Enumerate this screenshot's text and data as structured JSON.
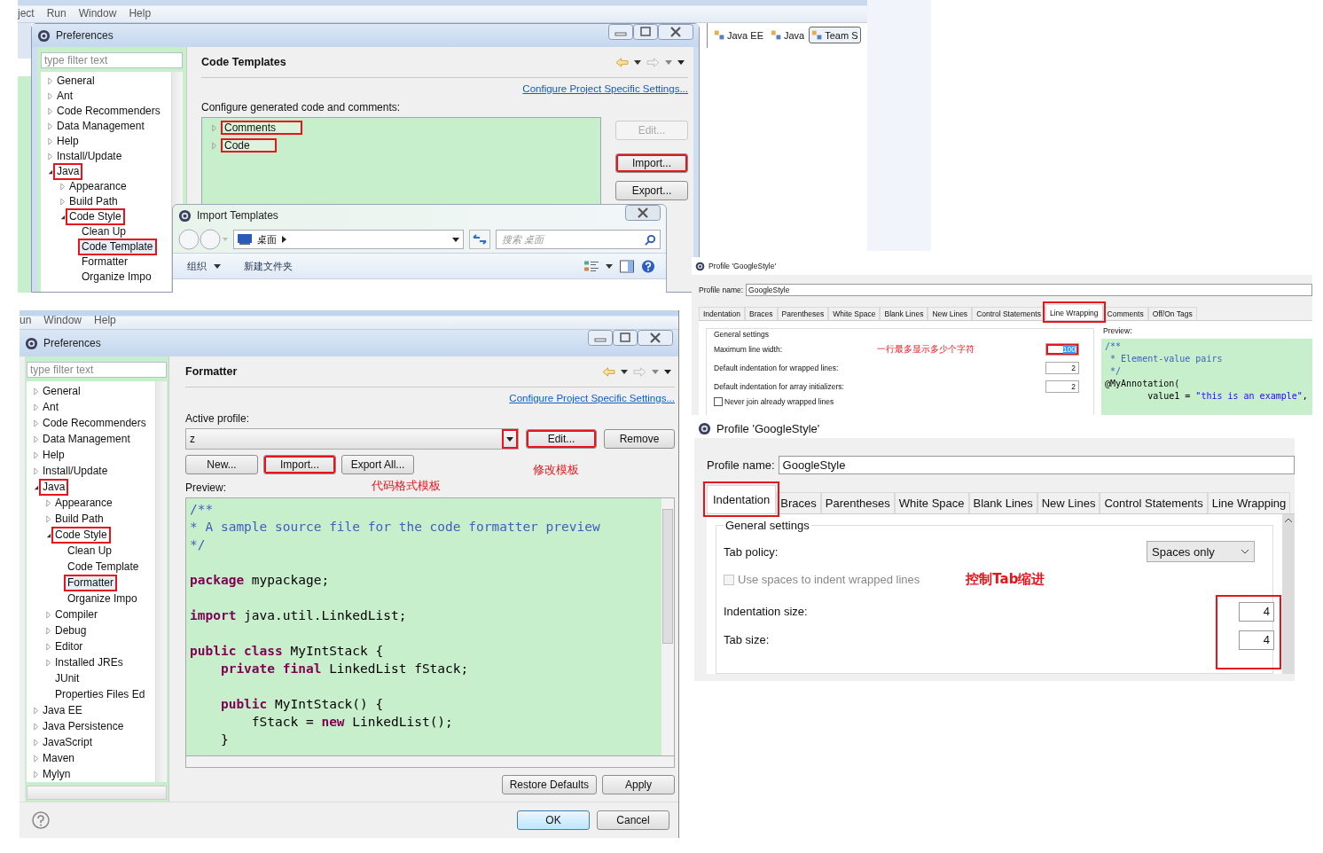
{
  "code_templates_window": {
    "menu": [
      "ject",
      "Run",
      "Window",
      "Help"
    ],
    "title": "Preferences",
    "filter": {
      "placeholder": "type filter text"
    },
    "tree": [
      {
        "label": "General",
        "expanded": false,
        "selected": false,
        "highlighted": false
      },
      {
        "label": "Ant",
        "expanded": false,
        "selected": false,
        "highlighted": false
      },
      {
        "label": "Code Recommenders",
        "expanded": false,
        "selected": false,
        "highlighted": false
      },
      {
        "label": "Data Management",
        "expanded": false,
        "selected": false,
        "highlighted": false
      },
      {
        "label": "Help",
        "expanded": false,
        "selected": false,
        "highlighted": false
      },
      {
        "label": "Install/Update",
        "expanded": false,
        "selected": false,
        "highlighted": false
      },
      {
        "label": "Java",
        "expanded": true,
        "selected": false,
        "highlighted": true,
        "children": [
          {
            "label": "Appearance",
            "expanded": false,
            "selected": false,
            "highlighted": false
          },
          {
            "label": "Build Path",
            "expanded": false,
            "selected": false,
            "highlighted": false
          },
          {
            "label": "Code Style",
            "expanded": true,
            "selected": false,
            "highlighted": true,
            "children": [
              {
                "label": "Clean Up",
                "selected": false,
                "highlighted": false
              },
              {
                "label": "Code Template",
                "selected": true,
                "highlighted": true
              },
              {
                "label": "Formatter",
                "selected": false,
                "highlighted": false
              },
              {
                "label": "Organize Impo",
                "selected": false,
                "highlighted": false
              }
            ]
          }
        ]
      }
    ],
    "page_title": "Code Templates",
    "link": "Configure Project Specific Settings...",
    "description": "Configure generated code and comments:",
    "templates": [
      {
        "label": "Comments",
        "expanded": false,
        "highlighted": true
      },
      {
        "label": "Code",
        "expanded": false,
        "highlighted": true
      }
    ],
    "buttons": [
      {
        "label": "Edit...",
        "disabled": true,
        "highlighted": false
      },
      {
        "label": "Import...",
        "disabled": false,
        "highlighted": true
      },
      {
        "label": "Export...",
        "disabled": false,
        "highlighted": false
      }
    ],
    "perspectives": [
      {
        "label": "Java EE",
        "selected": false
      },
      {
        "label": "Java",
        "selected": false
      },
      {
        "label": "Team S",
        "selected": true
      }
    ],
    "import_dialog": {
      "title": "Import Templates",
      "location": "桌面",
      "search": {
        "placeholder": "搜索 桌面"
      },
      "toolbar": [
        "组织",
        "新建文件夹"
      ]
    }
  },
  "formatter_window": {
    "menu": [
      "un",
      "Window",
      "Help"
    ],
    "title": "Preferences",
    "filter": {
      "placeholder": "type filter text"
    },
    "tree": [
      {
        "label": "General",
        "expanded": false,
        "selected": false,
        "highlighted": false
      },
      {
        "label": "Ant",
        "expanded": false,
        "selected": false,
        "highlighted": false
      },
      {
        "label": "Code Recommenders",
        "expanded": false,
        "selected": false,
        "highlighted": false
      },
      {
        "label": "Data Management",
        "expanded": false,
        "selected": false,
        "highlighted": false
      },
      {
        "label": "Help",
        "expanded": false,
        "selected": false,
        "highlighted": false
      },
      {
        "label": "Install/Update",
        "expanded": false,
        "selected": false,
        "highlighted": false
      },
      {
        "label": "Java",
        "expanded": true,
        "selected": false,
        "highlighted": true,
        "children": [
          {
            "label": "Appearance",
            "expanded": false,
            "selected": false,
            "highlighted": false
          },
          {
            "label": "Build Path",
            "expanded": false,
            "selected": false,
            "highlighted": false
          },
          {
            "label": "Code Style",
            "expanded": true,
            "selected": false,
            "highlighted": true,
            "children": [
              {
                "label": "Clean Up",
                "selected": false,
                "highlighted": false
              },
              {
                "label": "Code Template",
                "selected": false,
                "highlighted": false
              },
              {
                "label": "Formatter",
                "selected": true,
                "highlighted": true
              },
              {
                "label": "Organize Impo",
                "selected": false,
                "highlighted": false
              }
            ]
          },
          {
            "label": "Compiler",
            "expanded": false,
            "selected": false,
            "highlighted": false
          },
          {
            "label": "Debug",
            "expanded": false,
            "selected": false,
            "highlighted": false
          },
          {
            "label": "Editor",
            "expanded": false,
            "selected": false,
            "highlighted": false
          },
          {
            "label": "Installed JREs",
            "expanded": false,
            "selected": false,
            "highlighted": false
          },
          {
            "label": "JUnit",
            "selected": false,
            "highlighted": false
          },
          {
            "label": "Properties Files Ed",
            "selected": false,
            "highlighted": false
          }
        ]
      },
      {
        "label": "Java EE",
        "expanded": false,
        "selected": false,
        "highlighted": false
      },
      {
        "label": "Java Persistence",
        "expanded": false,
        "selected": false,
        "highlighted": false
      },
      {
        "label": "JavaScript",
        "expanded": false,
        "selected": false,
        "highlighted": false
      },
      {
        "label": "Maven",
        "expanded": false,
        "selected": false,
        "highlighted": false
      },
      {
        "label": "Mylyn",
        "expanded": false,
        "selected": false,
        "highlighted": false
      }
    ],
    "page_title": "Formatter",
    "link": "Configure Project Specific Settings...",
    "profile_label": "Active profile:",
    "profile": {
      "value": "z",
      "arrow_highlighted": true
    },
    "buttons": [
      {
        "label": "Edit...",
        "highlighted": true
      },
      {
        "label": "Remove",
        "highlighted": false
      }
    ],
    "profile_buttons": [
      {
        "label": "New...",
        "highlighted": false
      },
      {
        "label": "Import...",
        "highlighted": true
      },
      {
        "label": "Export All...",
        "highlighted": false
      }
    ],
    "edit_note": "修改模板",
    "preview_label": "Preview:",
    "preview_note": "代码格式模板",
    "code": [
      [
        [
          {
            "text": "/**",
            "kind": "comment"
          }
        ],
        [
          {
            "text": "* A sample source file for the code formatter preview",
            "kind": "comment"
          }
        ],
        [
          {
            "text": "*/",
            "kind": "comment"
          }
        ]
      ],
      [
        [
          {
            "text": "package",
            "kind": "keyword"
          },
          {
            "text": " mypackage;",
            "kind": "plain"
          }
        ]
      ],
      [
        [
          {
            "text": "import",
            "kind": "keyword"
          },
          {
            "text": " java.util.LinkedList;",
            "kind": "plain"
          }
        ]
      ],
      [
        [
          {
            "text": "public class",
            "kind": "keyword"
          },
          {
            "text": " MyIntStack {",
            "kind": "plain"
          }
        ],
        [
          {
            "text": "    private final",
            "kind": "keyword"
          },
          {
            "text": " LinkedList fStack;",
            "kind": "plain"
          }
        ]
      ],
      [
        [
          {
            "text": "    public",
            "kind": "keyword"
          },
          {
            "text": " MyIntStack() {",
            "kind": "plain"
          }
        ],
        [
          {
            "text": "        fStack = ",
            "kind": "plain"
          },
          {
            "text": "new",
            "kind": "keyword"
          },
          {
            "text": " LinkedList();",
            "kind": "plain"
          }
        ],
        [
          {
            "text": "    }",
            "kind": "plain"
          }
        ]
      ]
    ],
    "footer_buttons": [
      "Restore Defaults",
      "Apply"
    ],
    "dialog_buttons": [
      {
        "label": "OK",
        "default": true
      },
      {
        "label": "Cancel",
        "default": false
      }
    ]
  },
  "line_wrapping_profile": {
    "title": "Profile 'GoogleStyle'",
    "profile_name": {
      "label": "Profile name:",
      "value": "GoogleStyle"
    },
    "tabs": [
      {
        "label": "Indentation",
        "selected": false,
        "highlighted": false
      },
      {
        "label": "Braces",
        "selected": false,
        "highlighted": false
      },
      {
        "label": "Parentheses",
        "selected": false,
        "highlighted": false
      },
      {
        "label": "White Space",
        "selected": false,
        "highlighted": false
      },
      {
        "label": "Blank Lines",
        "selected": false,
        "highlighted": false
      },
      {
        "label": "New Lines",
        "selected": false,
        "highlighted": false
      },
      {
        "label": "Control Statements",
        "selected": false,
        "highlighted": false
      },
      {
        "label": "Line Wrapping",
        "selected": true,
        "highlighted": true
      },
      {
        "label": "Comments",
        "selected": false,
        "highlighted": false
      },
      {
        "label": "Off/On Tags",
        "selected": false,
        "highlighted": false
      }
    ],
    "group_title": "General settings",
    "fields": [
      {
        "label": "Maximum line width:",
        "value": "100",
        "highlighted": true,
        "text_selected": true
      },
      {
        "label": "Default indentation for wrapped lines:",
        "value": "2",
        "highlighted": false,
        "text_selected": false
      },
      {
        "label": "Default indentation for array initializers:",
        "value": "2",
        "highlighted": false,
        "text_selected": false
      }
    ],
    "note": "一行最多显示多少个字符",
    "checkbox": {
      "label": "Never join already wrapped lines",
      "checked": false
    },
    "preview_label": "Preview:",
    "preview": [
      [
        {
          "text": "/**",
          "kind": "comment"
        }
      ],
      [
        {
          "text": " * Element-value pairs",
          "kind": "comment"
        }
      ],
      [
        {
          "text": " */",
          "kind": "comment"
        }
      ],
      [
        {
          "text": "@MyAnnotation(",
          "kind": "plain"
        }
      ],
      [
        {
          "text": "        value1 = ",
          "kind": "plain"
        },
        {
          "text": "\"this is an example\"",
          "kind": "string"
        },
        {
          "text": ",",
          "kind": "plain"
        }
      ]
    ]
  },
  "indentation_profile": {
    "title": "Profile 'GoogleStyle'",
    "profile_name": {
      "label": "Profile name:",
      "value": "GoogleStyle"
    },
    "tabs": [
      {
        "label": "Indentation",
        "selected": true,
        "highlighted": true
      },
      {
        "label": "Braces",
        "selected": false,
        "highlighted": false
      },
      {
        "label": "Parentheses",
        "selected": false,
        "highlighted": false
      },
      {
        "label": "White Space",
        "selected": false,
        "highlighted": false
      },
      {
        "label": "Blank Lines",
        "selected": false,
        "highlighted": false
      },
      {
        "label": "New Lines",
        "selected": false,
        "highlighted": false
      },
      {
        "label": "Control Statements",
        "selected": false,
        "highlighted": false
      },
      {
        "label": "Line Wrapping",
        "selected": false,
        "highlighted": false
      }
    ],
    "group_title": "General settings",
    "tab_policy": {
      "label": "Tab policy:",
      "value": "Spaces only"
    },
    "checkbox": {
      "label": "Use spaces to indent wrapped lines",
      "checked": false,
      "disabled": true
    },
    "note": "控制Tab缩进",
    "sizes": {
      "highlighted": true,
      "fields": [
        {
          "label": "Indentation size:",
          "value": "4"
        },
        {
          "label": "Tab size:",
          "value": "4"
        }
      ]
    }
  }
}
